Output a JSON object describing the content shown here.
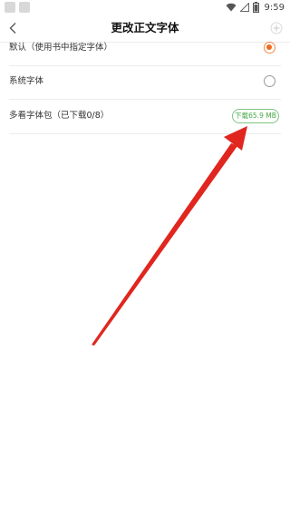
{
  "status_bar": {
    "time": "9:59",
    "icons": [
      "wifi-icon",
      "signal-icon",
      "battery-icon"
    ]
  },
  "header": {
    "title": "更改正文字体",
    "back_icon": "back-arrow-icon",
    "add_icon": "plus-icon"
  },
  "options": [
    {
      "label": "默认（使用书中指定字体）",
      "selected": true
    },
    {
      "label": "系统字体",
      "selected": false
    }
  ],
  "font_pack": {
    "label": "多看字体包（已下载0/8）",
    "download_label": "下载65.9 MB"
  },
  "colors": {
    "accent": "#f06b1e",
    "download_green": "#45a847",
    "annotation_arrow": "#e0261f"
  }
}
